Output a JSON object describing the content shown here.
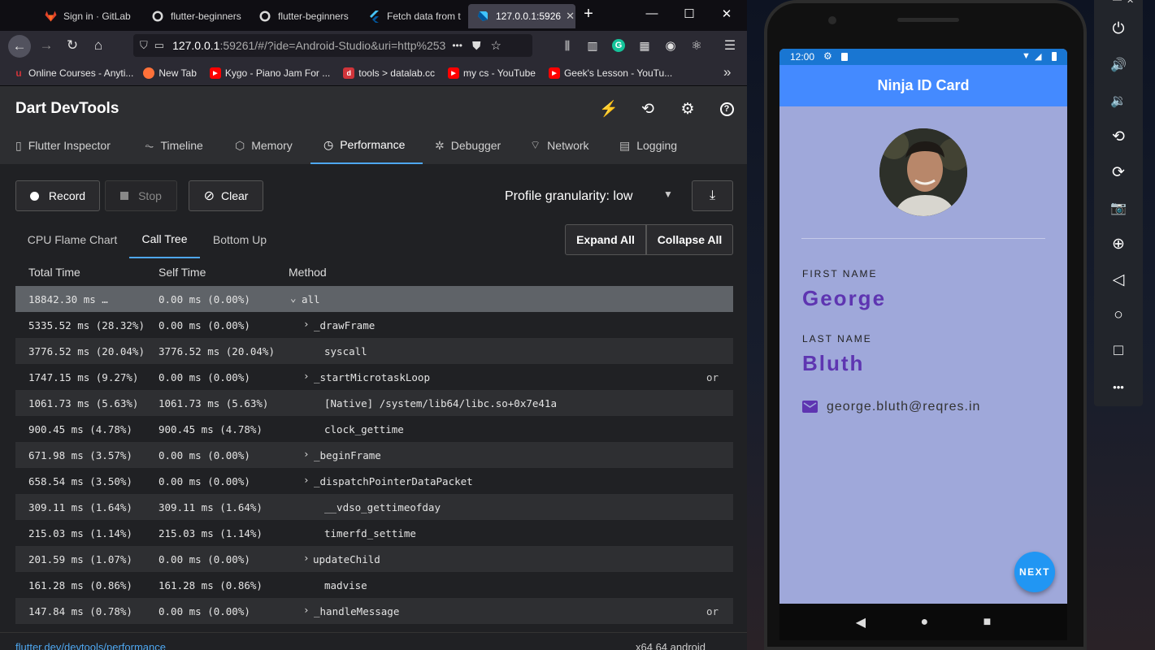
{
  "browser": {
    "tabs": [
      {
        "label": "Sign in · GitLab",
        "icon": "gitlab-icon"
      },
      {
        "label": "flutter-beginners",
        "icon": "github-icon"
      },
      {
        "label": "flutter-beginners",
        "icon": "github-icon"
      },
      {
        "label": "Fetch data from t",
        "icon": "flutter-icon"
      },
      {
        "label": "127.0.0.1:5926",
        "icon": "dart-icon"
      }
    ],
    "new_tab": "+",
    "window_controls": {
      "minimize": "—",
      "maximize": "☐",
      "close": "✕"
    },
    "url_host": "127.0.0.1",
    "url_rest": ":59261/#/?ide=Android-Studio&uri=http%253",
    "page_actions": "•••",
    "bookmarks": [
      {
        "label": "Online Courses - Anyti...",
        "color": "#d0343a"
      },
      {
        "label": "New Tab",
        "color": "#ff7139"
      },
      {
        "label": "Kygo - Piano Jam For ...",
        "color": "#ff0000"
      },
      {
        "label": "tools > datalab.cc",
        "color": "#d0343a"
      },
      {
        "label": "my cs - YouTube",
        "color": "#ff0000"
      },
      {
        "label": "Geek's Lesson - YouTu...",
        "color": "#ff0000"
      }
    ],
    "bookmarks_overflow": "»"
  },
  "devtools": {
    "title": "Dart DevTools",
    "tabs": [
      {
        "label": "Flutter Inspector",
        "icon": "▯"
      },
      {
        "label": "Timeline",
        "icon": "⏦"
      },
      {
        "label": "Memory",
        "icon": "⬡"
      },
      {
        "label": "Performance",
        "icon": "◷"
      },
      {
        "label": "Debugger",
        "icon": "✲"
      },
      {
        "label": "Network",
        "icon": "⌔"
      },
      {
        "label": "Logging",
        "icon": "▤"
      }
    ],
    "controls": {
      "record": "Record",
      "stop": "Stop",
      "clear": "Clear",
      "granularity": "Profile granularity: low",
      "granularity_caret": "▼"
    },
    "subtabs": [
      "CPU Flame Chart",
      "Call Tree",
      "Bottom Up"
    ],
    "expand_all": "Expand All",
    "collapse_all": "Collapse All",
    "columns": {
      "total": "Total Time",
      "self": "Self Time",
      "method": "Method"
    },
    "rows": [
      {
        "total": "18842.30 ms …",
        "self": "0.00 ms (0.00%)",
        "arrow": "⌄",
        "method": "all",
        "extra": ""
      },
      {
        "total": "5335.52 ms (28.32%)",
        "self": "0.00 ms (0.00%)",
        "arrow": "›",
        "method": "_drawFrame",
        "extra": ""
      },
      {
        "total": "3776.52 ms (20.04%)",
        "self": "3776.52 ms (20.04%)",
        "arrow": "",
        "method": "syscall",
        "extra": ""
      },
      {
        "total": "1747.15 ms (9.27%)",
        "self": "0.00 ms (0.00%)",
        "arrow": "›",
        "method": "_startMicrotaskLoop",
        "extra": "or"
      },
      {
        "total": "1061.73 ms (5.63%)",
        "self": "1061.73 ms (5.63%)",
        "arrow": "",
        "method": "[Native] /system/lib64/libc.so+0x7e41a",
        "extra": ""
      },
      {
        "total": "900.45 ms (4.78%)",
        "self": "900.45 ms (4.78%)",
        "arrow": "",
        "method": "clock_gettime",
        "extra": ""
      },
      {
        "total": "671.98 ms (3.57%)",
        "self": "0.00 ms (0.00%)",
        "arrow": "›",
        "method": "_beginFrame",
        "extra": ""
      },
      {
        "total": "658.54 ms (3.50%)",
        "self": "0.00 ms (0.00%)",
        "arrow": "›",
        "method": "_dispatchPointerDataPacket",
        "extra": ""
      },
      {
        "total": "309.11 ms (1.64%)",
        "self": "309.11 ms (1.64%)",
        "arrow": "",
        "method": "__vdso_gettimeofday",
        "extra": ""
      },
      {
        "total": "215.03 ms (1.14%)",
        "self": "215.03 ms (1.14%)",
        "arrow": "",
        "method": "timerfd_settime",
        "extra": ""
      },
      {
        "total": "201.59 ms (1.07%)",
        "self": "0.00 ms (0.00%)",
        "arrow": "›",
        "method": "updateChild",
        "extra": ""
      },
      {
        "total": "161.28 ms (0.86%)",
        "self": "161.28 ms (0.86%)",
        "arrow": "",
        "method": "madvise",
        "extra": ""
      },
      {
        "total": "147.84 ms (0.78%)",
        "self": "0.00 ms (0.00%)",
        "arrow": "›",
        "method": "_handleMessage",
        "extra": "or"
      }
    ],
    "status_link": "flutter.dev/devtools/performance",
    "status_right": "x64 64 android"
  },
  "phone": {
    "time": "12:00",
    "app_title": "Ninja ID Card",
    "first_name_label": "FIRST NAME",
    "first_name": "George",
    "last_name_label": "LAST NAME",
    "last_name": "Bluth",
    "email": "george.bluth@reqres.in",
    "fab_label": "NEXT",
    "nav": {
      "back": "◀",
      "home": "●",
      "recents": "■"
    }
  },
  "emulator_toolbar": [
    {
      "name": "power-icon",
      "glyph": "⏻"
    },
    {
      "name": "volume-up-icon",
      "glyph": "🔊"
    },
    {
      "name": "volume-down-icon",
      "glyph": "🔉"
    },
    {
      "name": "rotate-left-icon",
      "glyph": "⟲"
    },
    {
      "name": "rotate-right-icon",
      "glyph": "⟳"
    },
    {
      "name": "camera-icon",
      "glyph": "📷"
    },
    {
      "name": "zoom-icon",
      "glyph": "⊕"
    },
    {
      "name": "back-icon",
      "glyph": "◁"
    },
    {
      "name": "home-icon",
      "glyph": "○"
    },
    {
      "name": "overview-icon",
      "glyph": "□"
    },
    {
      "name": "more-icon",
      "glyph": "•••"
    }
  ]
}
